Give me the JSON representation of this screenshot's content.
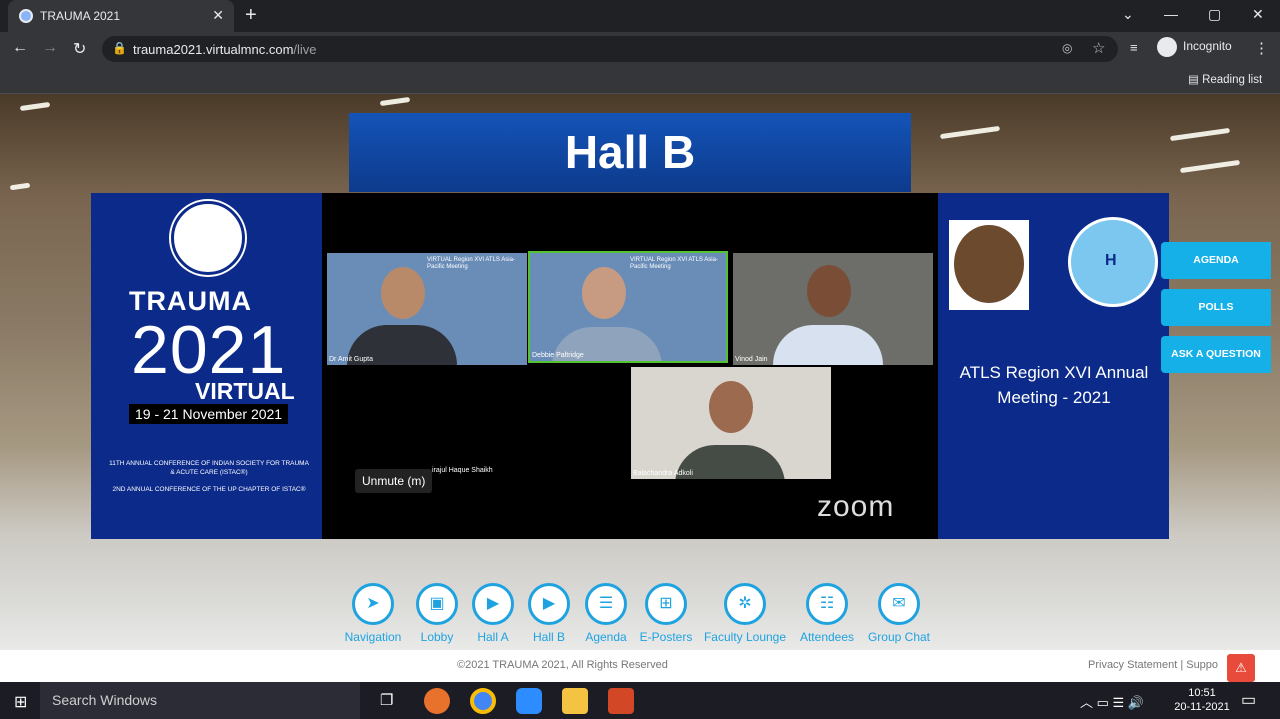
{
  "browser": {
    "tab_title": "TRAUMA 2021",
    "tab_close": "✕",
    "new_tab": "+",
    "url_host": "trauma2021.virtualmnc.com",
    "url_path": "/live",
    "profile_label": "Incognito",
    "reading_list": "Reading list",
    "window_controls": [
      "⌄",
      "—",
      "▢",
      "✕"
    ]
  },
  "page": {
    "hall_title": "Hall B",
    "left_banner": {
      "line1": "TRAUMA",
      "line2": "2021",
      "line3": "VIRTUAL",
      "dates": "19 - 21 November 2021",
      "conf1": "11TH ANNUAL CONFERENCE OF INDIAN SOCIETY FOR TRAUMA & ACUTE CARE (ISTAC®)",
      "conf2": "2ND ANNUAL CONFERENCE OF THE UP CHAPTER OF ISTAC®"
    },
    "right_banner": {
      "title": "ATLS Region XVI Annual Meeting - 2021",
      "badge_text": "H"
    },
    "side_buttons": [
      "AGENDA",
      "POLLS",
      "ASK A QUESTION"
    ],
    "zoom": {
      "participants": [
        {
          "name": "Dr Amit Gupta",
          "banner": "VIRTUAL Region XVI ATLS Asia-Pacific Meeting"
        },
        {
          "name": "Debbie Paltridge",
          "banner": "VIRTUAL Region XVI ATLS Asia-Pacific Meeting"
        },
        {
          "name": "Vinod Jain",
          "banner": ""
        },
        {
          "name": "Balachandra Adkoli",
          "banner": ""
        }
      ],
      "hidden_participant": "irajul Haque Shaikh",
      "unmute_label": "Unmute (m)",
      "logo": "zoom"
    },
    "nav_items": [
      {
        "label": "Navigation",
        "icon": "navigation-icon",
        "glyph": "➤"
      },
      {
        "label": "Lobby",
        "icon": "lobby-icon",
        "glyph": "▣"
      },
      {
        "label": "Hall A",
        "icon": "hall-a-icon",
        "glyph": "▶"
      },
      {
        "label": "Hall B",
        "icon": "hall-b-icon",
        "glyph": "▶"
      },
      {
        "label": "Agenda",
        "icon": "agenda-icon",
        "glyph": "☰"
      },
      {
        "label": "E-Posters",
        "icon": "eposters-icon",
        "glyph": "⊞"
      },
      {
        "label": "Faculty Lounge",
        "icon": "faculty-lounge-icon",
        "glyph": "✲"
      },
      {
        "label": "Attendees",
        "icon": "attendees-icon",
        "glyph": "☷"
      },
      {
        "label": "Group Chat",
        "icon": "group-chat-icon",
        "glyph": "✉"
      }
    ],
    "footer": {
      "copyright": "©2021 TRAUMA 2021, All Rights Reserved",
      "privacy": "Privacy Statement | Suppo",
      "warn_glyph": "⚠"
    }
  },
  "taskbar": {
    "search_placeholder": "Search Windows",
    "time": "10:51",
    "date": "20-11-2021",
    "colors": {
      "firefox": "#e8712c",
      "chrome": "#4285f4",
      "zoom": "#2d8cff",
      "explorer": "#f5c342",
      "powerpoint": "#d24726"
    }
  }
}
